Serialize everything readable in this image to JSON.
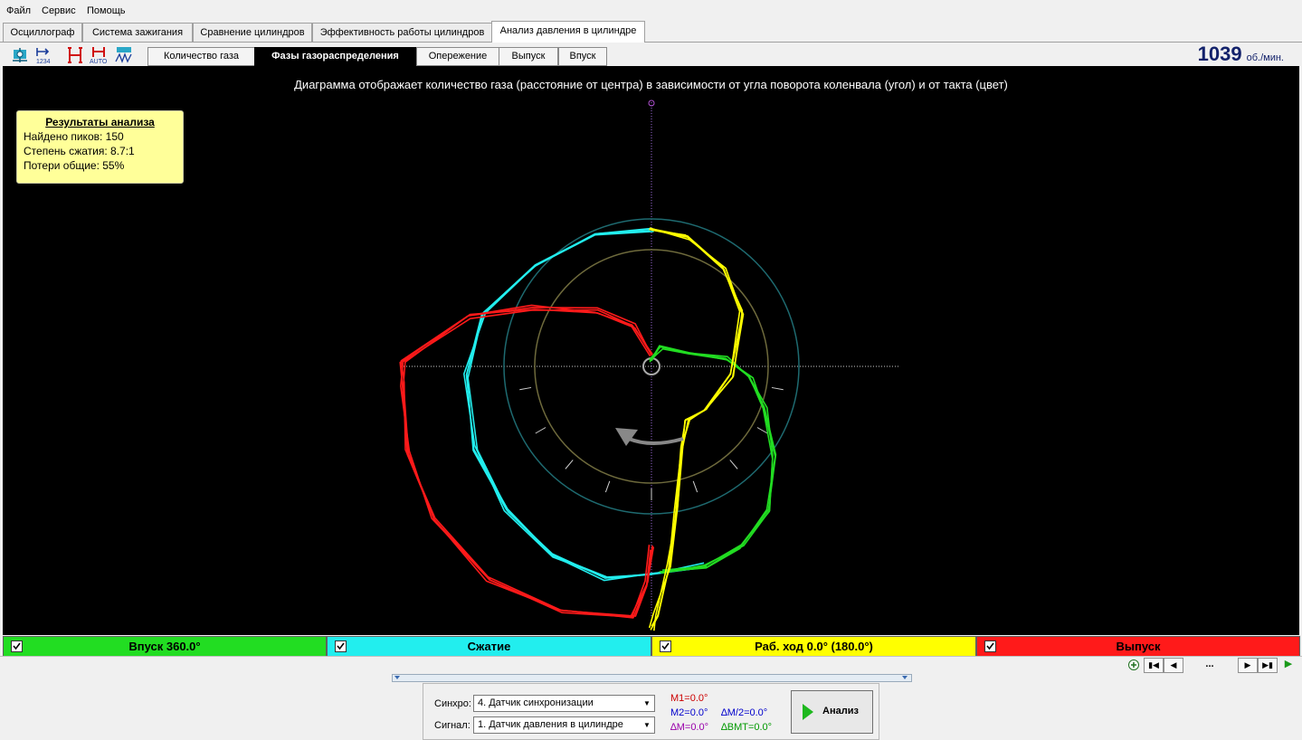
{
  "menu": {
    "items": [
      "Файл",
      "Сервис",
      "Помощь"
    ]
  },
  "main_tabs": [
    {
      "label": "Осциллограф"
    },
    {
      "label": "Система зажигания"
    },
    {
      "label": "Сравнение цилиндров"
    },
    {
      "label": "Эффективность работы цилиндров"
    },
    {
      "label": "Анализ давления в цилиндре",
      "active": true
    }
  ],
  "toolbar": {
    "icons": [
      "cursor-icon",
      "numbers-icon",
      "markers-icon",
      "auto-markers-icon",
      "waveform-icon"
    ]
  },
  "sub_tabs": [
    {
      "label": "Количество газа"
    },
    {
      "label": "Фазы газораспределения",
      "active": true
    },
    {
      "label": "Опережение"
    },
    {
      "label": "Выпуск"
    },
    {
      "label": "Впуск"
    }
  ],
  "rpm": {
    "value": "1039",
    "unit": "об./мин."
  },
  "plot": {
    "caption": "Диаграмма отображает количество газа (расстояние от центра) в зависимости от угла поворота коленвала (угол) и от такта (цвет)",
    "background": "#000000"
  },
  "results": {
    "title": "Результаты анализа",
    "rows": [
      "Найдено пиков: 150",
      "Степень сжатия: 8.7:1",
      "Потери общие: 55%"
    ]
  },
  "strokes": [
    {
      "label": "Впуск 360.0°",
      "color": "#22dd22",
      "checked": true
    },
    {
      "label": "Сжатие",
      "color": "#22eeee",
      "checked": true
    },
    {
      "label": "Раб. ход 0.0° (180.0°)",
      "color": "#ffff00",
      "checked": true
    },
    {
      "label": "Выпуск",
      "color": "#ff1a1a",
      "checked": true
    }
  ],
  "nav": {
    "position_label": "..."
  },
  "controls": {
    "sync_label": "Синхро:",
    "sync_value": "4.  Датчик синхронизации",
    "signal_label": "Сигнал:",
    "signal_value": "1.  Датчик давления в цилиндре",
    "markers": {
      "m1": "M1=0.0°",
      "m2": "M2=0.0°",
      "dm": "∆M=0.0°",
      "dm2": "∆M/2=0.0°",
      "dbmt": "∆ВМТ=0.0°"
    },
    "analyze_label": "Анализ"
  }
}
